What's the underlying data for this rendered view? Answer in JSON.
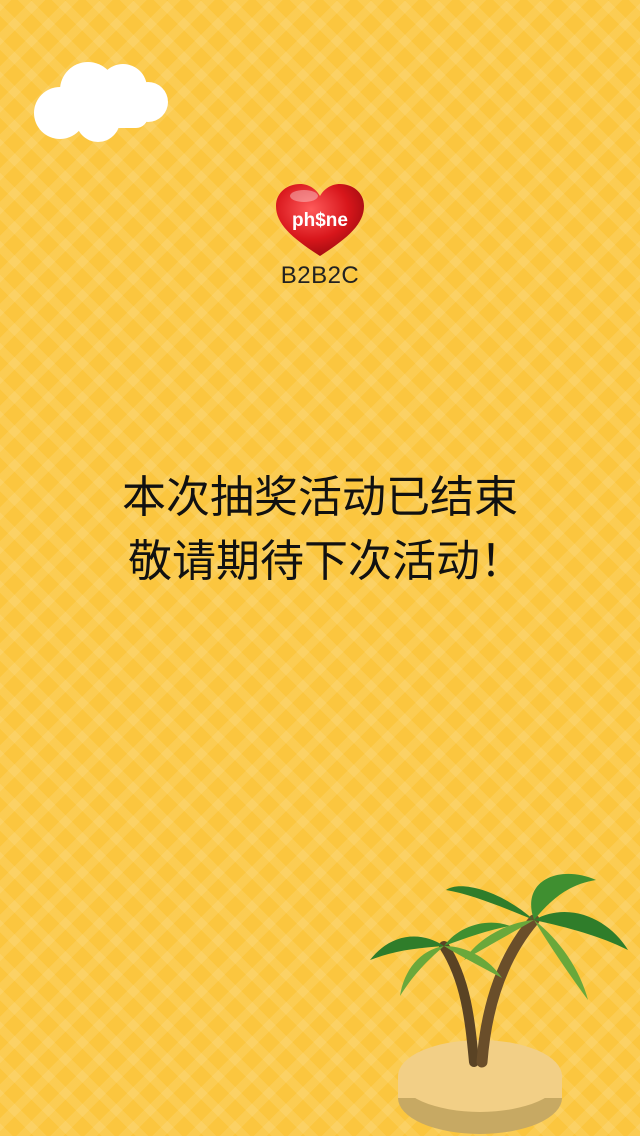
{
  "brand": {
    "logo_text": "ph$ne",
    "subtitle": "B2B2C"
  },
  "message": {
    "line1": "本次抽奖活动已结束",
    "line2": "敬请期待下次活动！"
  },
  "decorations": {
    "cloud": "cloud-icon",
    "island": "palm-island-icon"
  },
  "colors": {
    "background": "#fbc63f",
    "heart": "#d8161b",
    "leaf_dark": "#2f7d2a",
    "leaf_light": "#6aa83b",
    "trunk": "#5a4324",
    "sand": "#f2cf86"
  }
}
